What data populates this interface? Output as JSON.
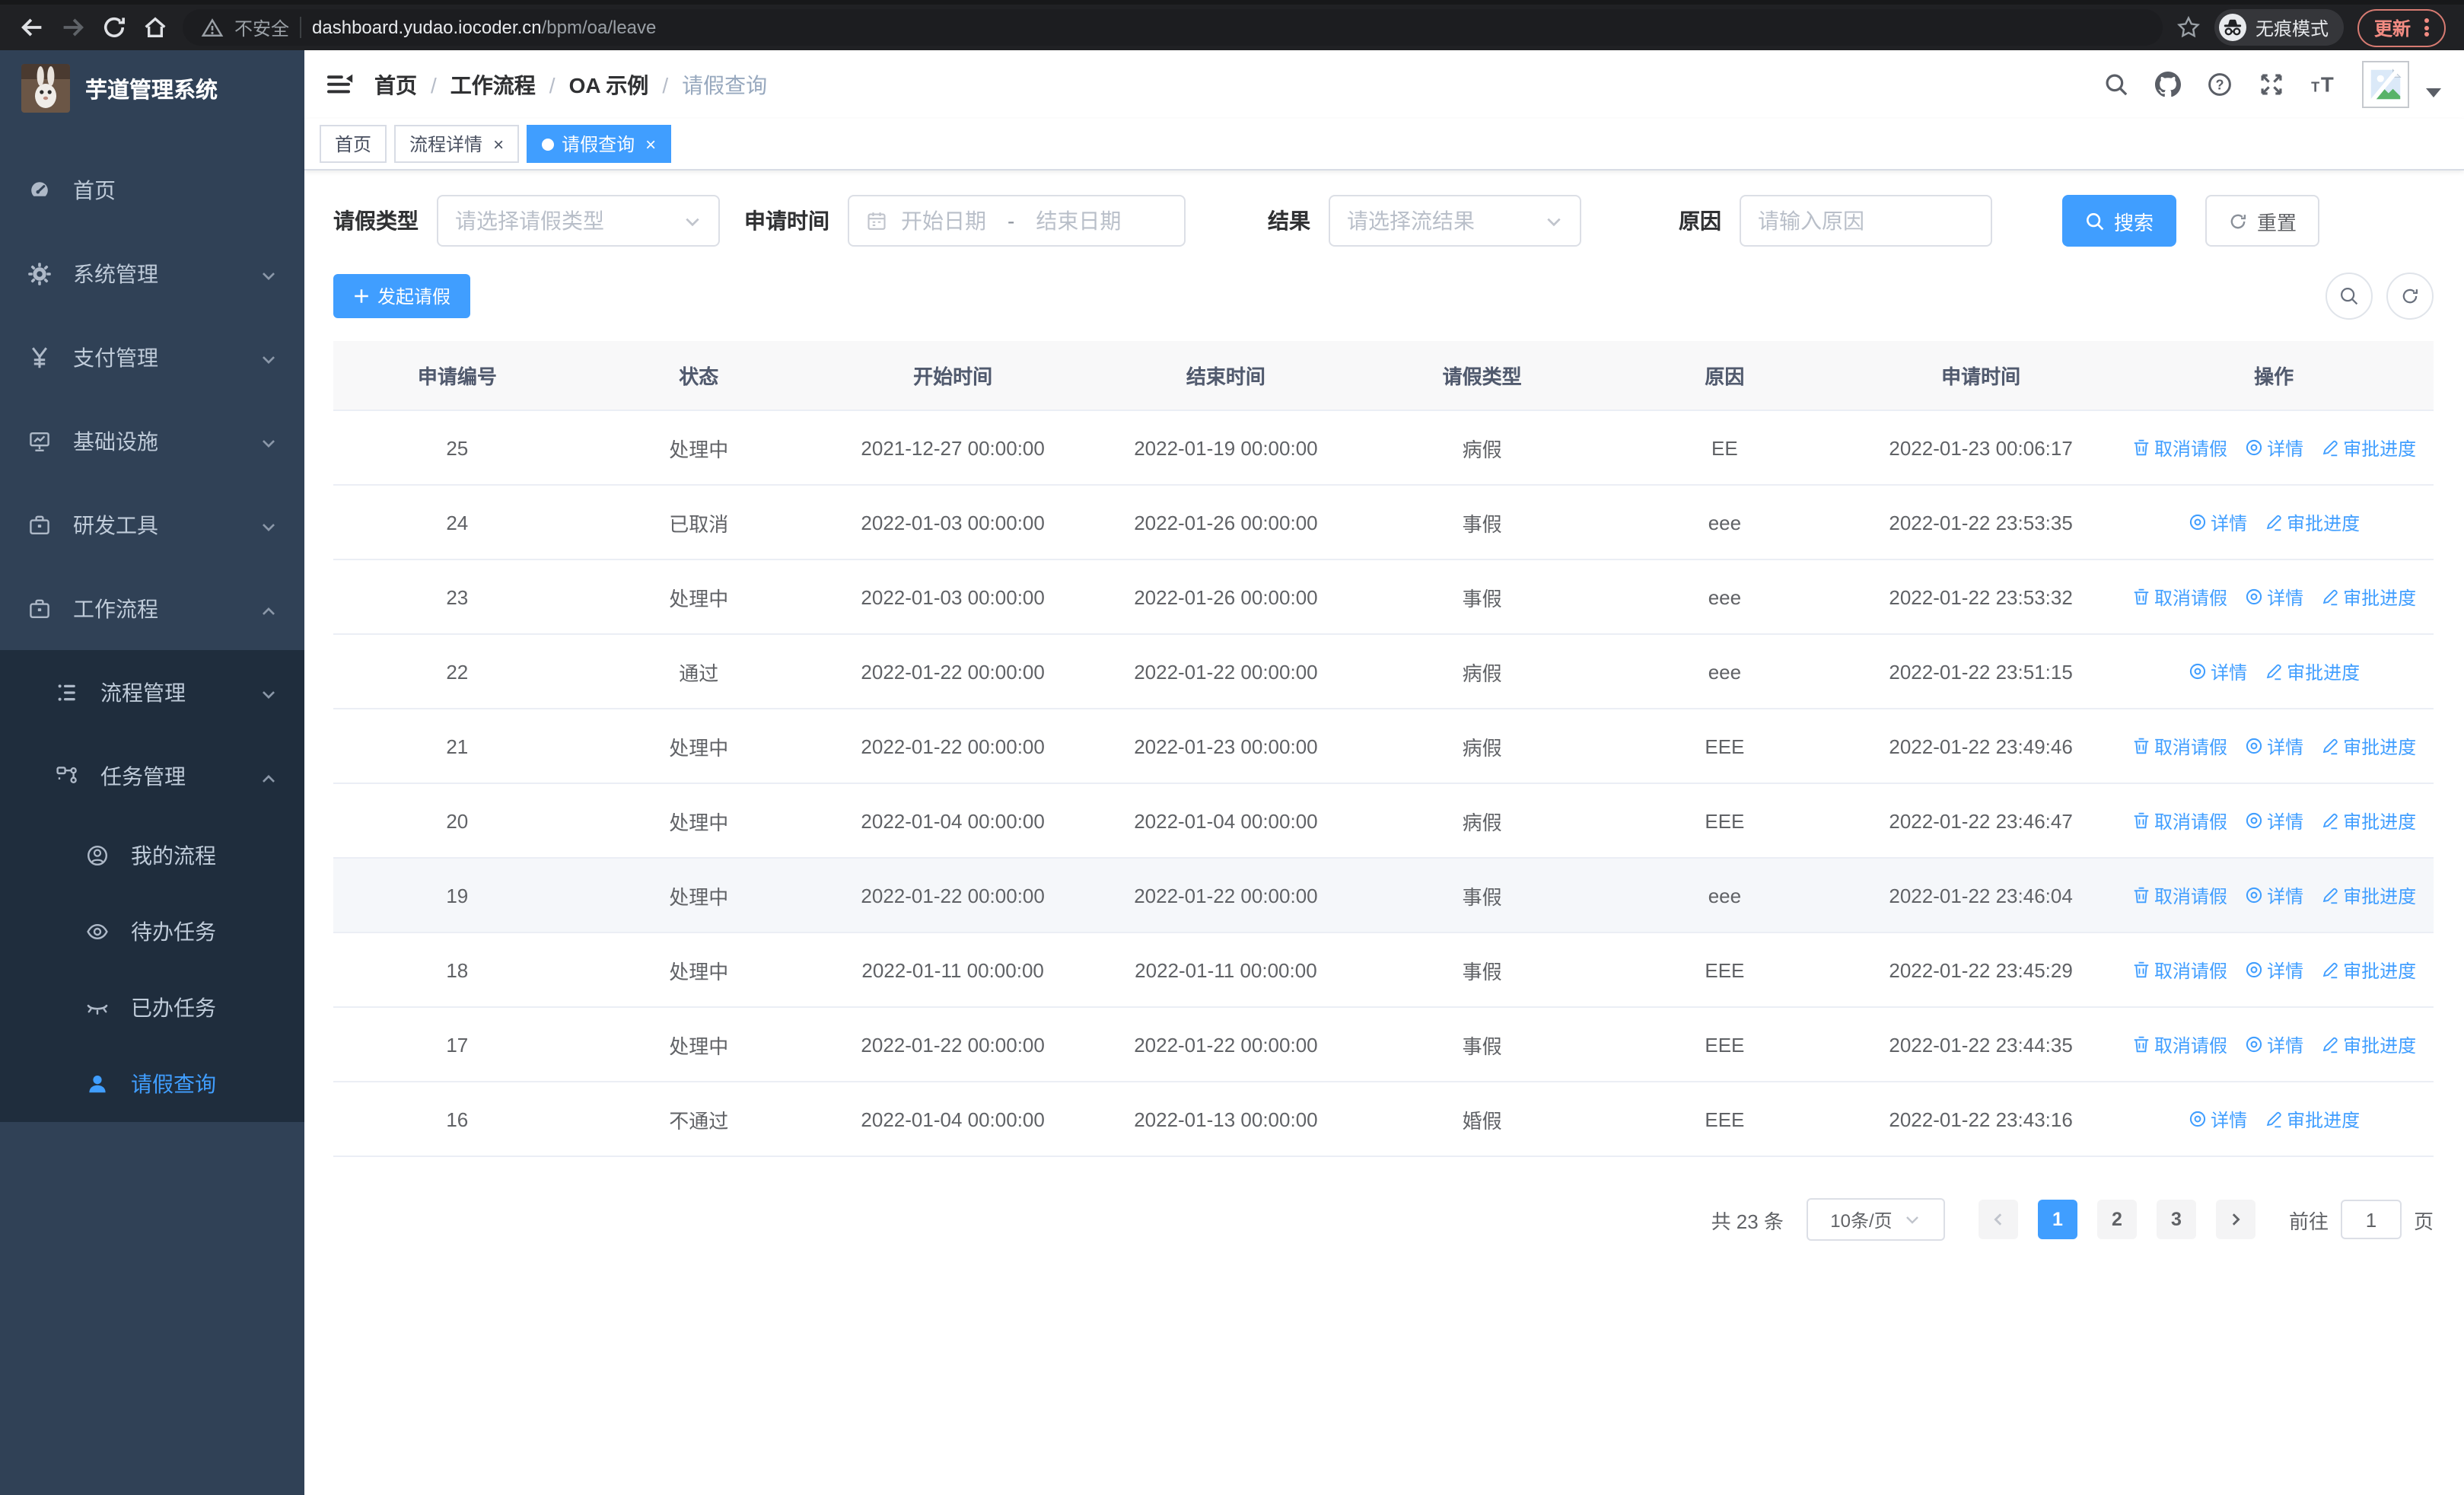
{
  "browser": {
    "security_label": "不安全",
    "url_host": "dashboard.yudao.iocoder.cn",
    "url_path": "/bpm/oa/leave",
    "incognito_label": "无痕模式",
    "update_label": "更新"
  },
  "colors": {
    "primary": "#409eff",
    "sidebar_bg": "#304156",
    "submenu_bg": "#1f2d3d",
    "sidebar_text": "#bfcbd9"
  },
  "sidebar": {
    "title": "芋道管理系统",
    "items": [
      {
        "label": "首页",
        "icon": "dashboard-icon"
      },
      {
        "label": "系统管理",
        "icon": "gear-icon",
        "arrow": "down"
      },
      {
        "label": "支付管理",
        "icon": "yen-icon",
        "arrow": "down"
      },
      {
        "label": "基础设施",
        "icon": "infrastructure-icon",
        "arrow": "down"
      },
      {
        "label": "研发工具",
        "icon": "briefcase-icon",
        "arrow": "down"
      },
      {
        "label": "工作流程",
        "icon": "briefcase-icon",
        "arrow": "up"
      }
    ],
    "submenu": [
      {
        "label": "流程管理",
        "icon": "list-icon",
        "arrow": "down"
      },
      {
        "label": "任务管理",
        "icon": "flow-icon",
        "arrow": "up"
      },
      {
        "label": "我的流程",
        "icon": "user-circle-icon"
      },
      {
        "label": "待办任务",
        "icon": "eye-icon"
      },
      {
        "label": "已办任务",
        "icon": "eye-closed-icon"
      },
      {
        "label": "请假查询",
        "icon": "user-icon",
        "active": true
      }
    ]
  },
  "navbar": {
    "breadcrumb": [
      "首页",
      "工作流程",
      "OA 示例",
      "请假查询"
    ]
  },
  "tabs": [
    {
      "label": "首页",
      "closable": false,
      "active": false
    },
    {
      "label": "流程详情",
      "closable": true,
      "active": false
    },
    {
      "label": "请假查询",
      "closable": true,
      "active": true
    }
  ],
  "filters": {
    "leave_type": {
      "label": "请假类型",
      "placeholder": "请选择请假类型"
    },
    "apply_time": {
      "label": "申请时间",
      "start_placeholder": "开始日期",
      "separator": "-",
      "end_placeholder": "结束日期"
    },
    "result": {
      "label": "结果",
      "placeholder": "请选择流结果"
    },
    "reason": {
      "label": "原因",
      "placeholder": "请输入原因"
    },
    "search_label": "搜索",
    "reset_label": "重置"
  },
  "toolbar": {
    "create_label": "发起请假"
  },
  "table": {
    "columns": [
      "申请编号",
      "状态",
      "开始时间",
      "结束时间",
      "请假类型",
      "原因",
      "申请时间",
      "操作"
    ],
    "action_labels": {
      "cancel": "取消请假",
      "detail": "详情",
      "progress": "审批进度"
    },
    "rows": [
      {
        "id": "25",
        "status": "处理中",
        "start": "2021-12-27 00:00:00",
        "end": "2022-01-19 00:00:00",
        "type": "病假",
        "reason": "EE",
        "apply_time": "2022-01-23 00:06:17",
        "actions": [
          "cancel",
          "detail",
          "progress"
        ]
      },
      {
        "id": "24",
        "status": "已取消",
        "start": "2022-01-03 00:00:00",
        "end": "2022-01-26 00:00:00",
        "type": "事假",
        "reason": "eee",
        "apply_time": "2022-01-22 23:53:35",
        "actions": [
          "detail",
          "progress"
        ]
      },
      {
        "id": "23",
        "status": "处理中",
        "start": "2022-01-03 00:00:00",
        "end": "2022-01-26 00:00:00",
        "type": "事假",
        "reason": "eee",
        "apply_time": "2022-01-22 23:53:32",
        "actions": [
          "cancel",
          "detail",
          "progress"
        ]
      },
      {
        "id": "22",
        "status": "通过",
        "start": "2022-01-22 00:00:00",
        "end": "2022-01-22 00:00:00",
        "type": "病假",
        "reason": "eee",
        "apply_time": "2022-01-22 23:51:15",
        "actions": [
          "detail",
          "progress"
        ]
      },
      {
        "id": "21",
        "status": "处理中",
        "start": "2022-01-22 00:00:00",
        "end": "2022-01-23 00:00:00",
        "type": "病假",
        "reason": "EEE",
        "apply_time": "2022-01-22 23:49:46",
        "actions": [
          "cancel",
          "detail",
          "progress"
        ]
      },
      {
        "id": "20",
        "status": "处理中",
        "start": "2022-01-04 00:00:00",
        "end": "2022-01-04 00:00:00",
        "type": "病假",
        "reason": "EEE",
        "apply_time": "2022-01-22 23:46:47",
        "actions": [
          "cancel",
          "detail",
          "progress"
        ]
      },
      {
        "id": "19",
        "status": "处理中",
        "start": "2022-01-22 00:00:00",
        "end": "2022-01-22 00:00:00",
        "type": "事假",
        "reason": "eee",
        "apply_time": "2022-01-22 23:46:04",
        "actions": [
          "cancel",
          "detail",
          "progress"
        ],
        "highlight": true
      },
      {
        "id": "18",
        "status": "处理中",
        "start": "2022-01-11 00:00:00",
        "end": "2022-01-11 00:00:00",
        "type": "事假",
        "reason": "EEE",
        "apply_time": "2022-01-22 23:45:29",
        "actions": [
          "cancel",
          "detail",
          "progress"
        ]
      },
      {
        "id": "17",
        "status": "处理中",
        "start": "2022-01-22 00:00:00",
        "end": "2022-01-22 00:00:00",
        "type": "事假",
        "reason": "EEE",
        "apply_time": "2022-01-22 23:44:35",
        "actions": [
          "cancel",
          "detail",
          "progress"
        ]
      },
      {
        "id": "16",
        "status": "不通过",
        "start": "2022-01-04 00:00:00",
        "end": "2022-01-13 00:00:00",
        "type": "婚假",
        "reason": "EEE",
        "apply_time": "2022-01-22 23:43:16",
        "actions": [
          "detail",
          "progress"
        ]
      }
    ]
  },
  "pagination": {
    "total_label": "共 23 条",
    "page_size": "10条/页",
    "pages": [
      "1",
      "2",
      "3"
    ],
    "active_page": "1",
    "goto_label": "前往",
    "goto_value": "1",
    "unit_label": "页"
  }
}
